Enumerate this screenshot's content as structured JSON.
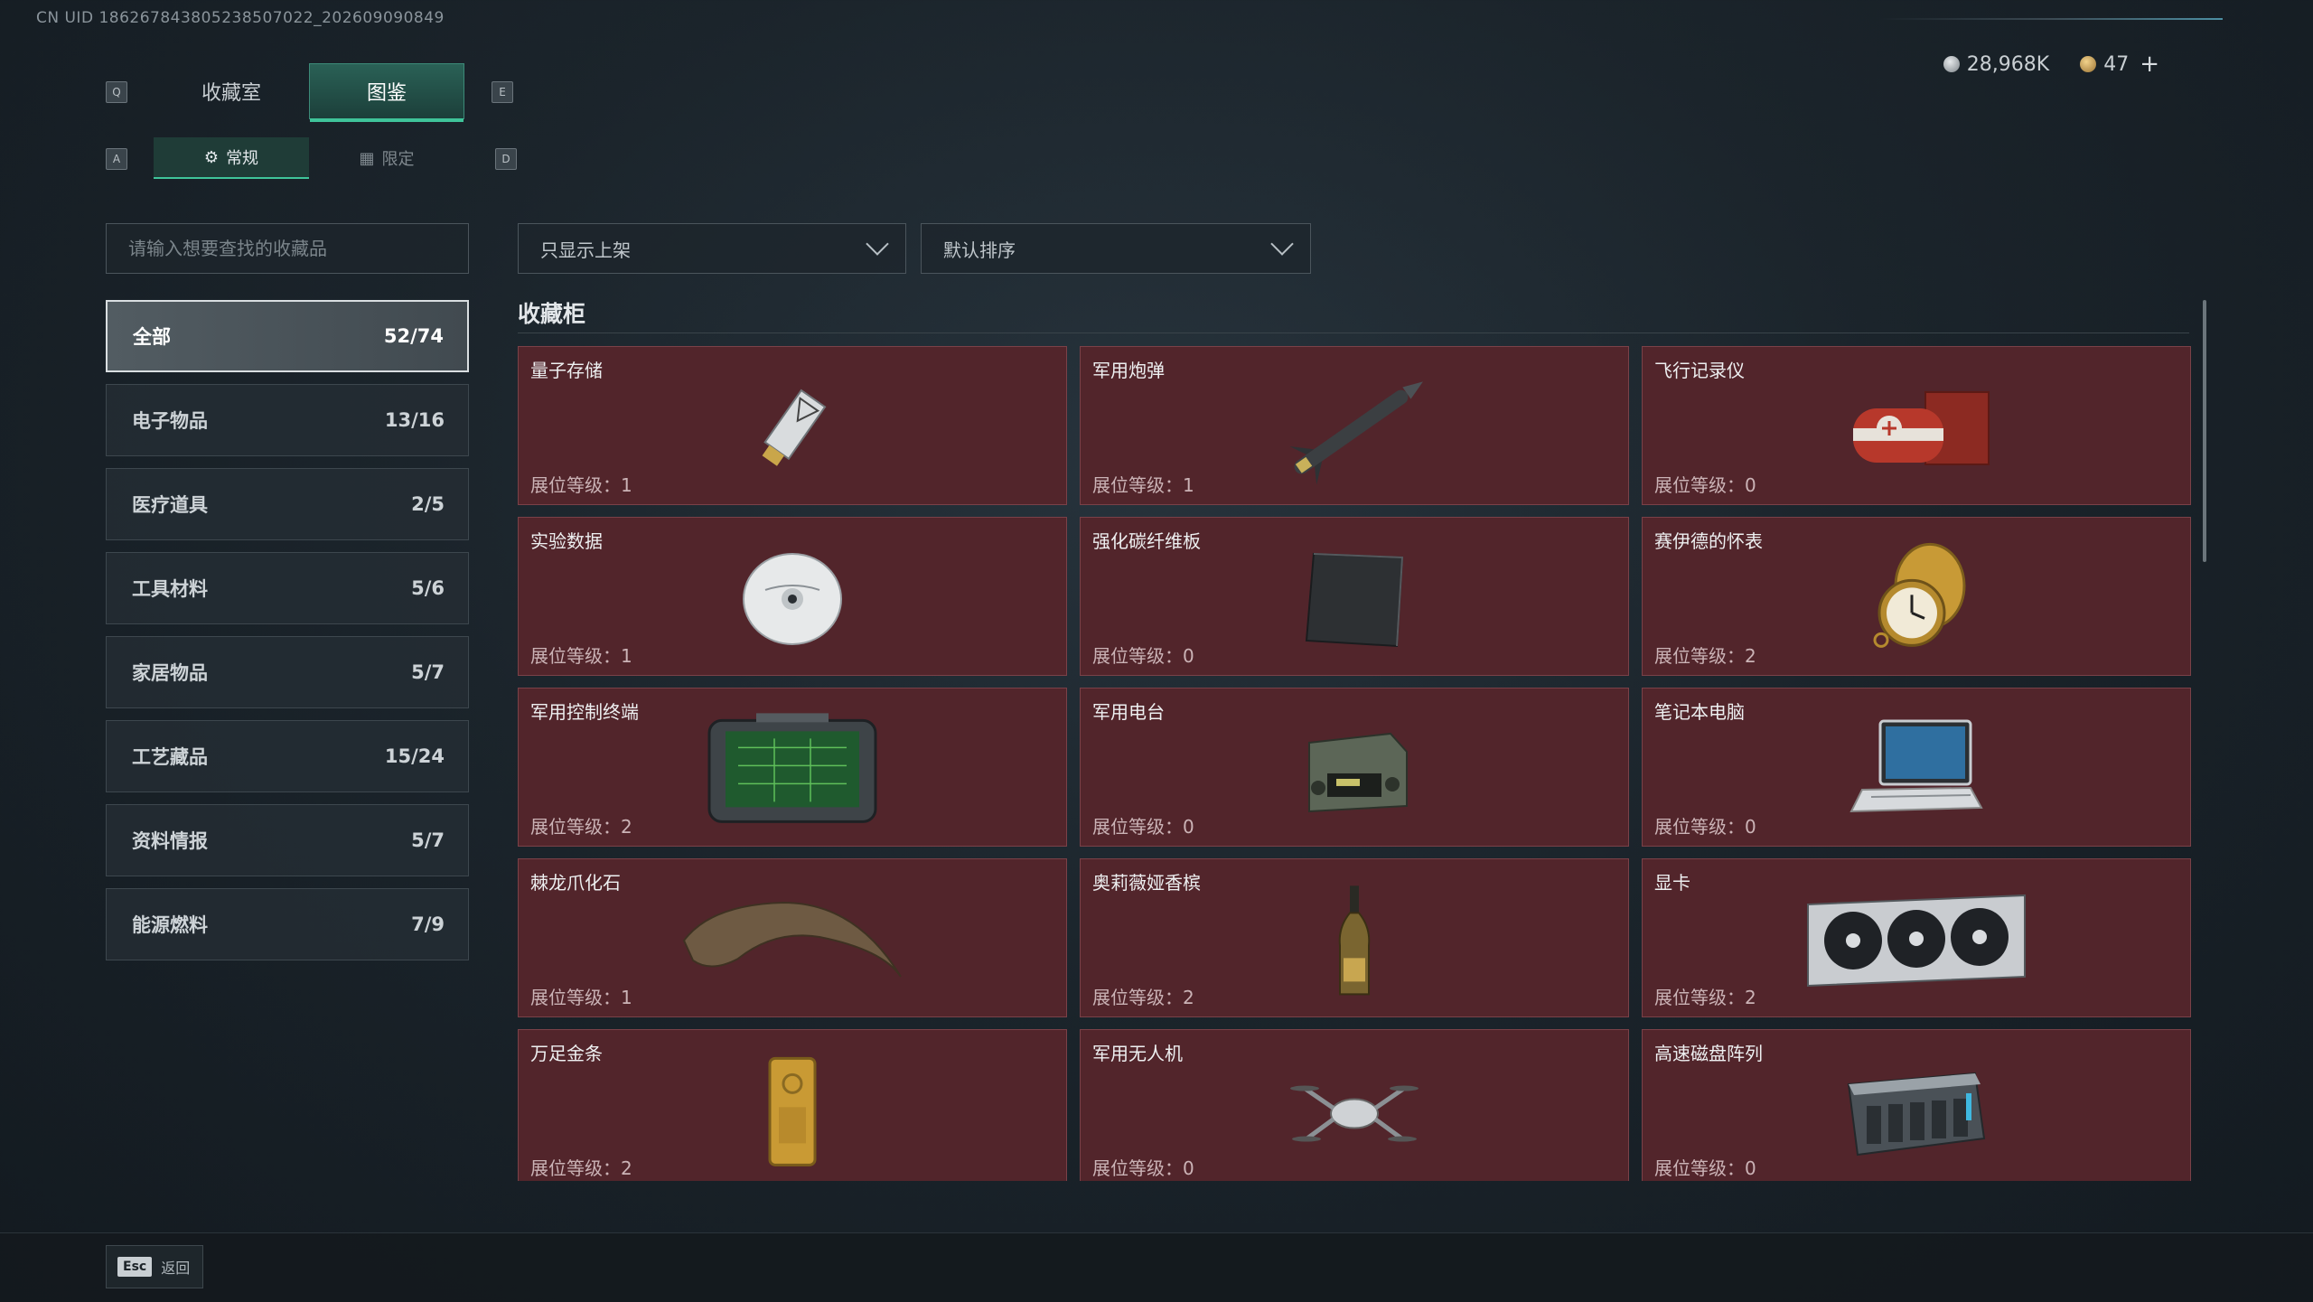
{
  "header": {
    "uid": "CN UID 1862678438052385070​22_202609090849"
  },
  "currency": {
    "silver": "28,968K",
    "gold": "47",
    "add": "+"
  },
  "tabs": {
    "prev_key": "Q",
    "next_key": "E",
    "items": [
      {
        "label": "收藏室"
      },
      {
        "label": "图鉴"
      }
    ]
  },
  "subtabs": {
    "prev_key": "A",
    "next_key": "D",
    "items": [
      {
        "label": "常规"
      },
      {
        "label": "限定"
      }
    ]
  },
  "search": {
    "placeholder": "请输入想要查找的收藏品"
  },
  "filters": {
    "shelf": "只显示上架",
    "sort": "默认排序"
  },
  "categories": [
    {
      "label": "全部",
      "count": "52/74"
    },
    {
      "label": "电子物品",
      "count": "13/16"
    },
    {
      "label": "医疗道具",
      "count": "2/5"
    },
    {
      "label": "工具材料",
      "count": "5/6"
    },
    {
      "label": "家居物品",
      "count": "5/7"
    },
    {
      "label": "工艺藏品",
      "count": "15/24"
    },
    {
      "label": "资料情报",
      "count": "5/7"
    },
    {
      "label": "能源燃料",
      "count": "7/9"
    }
  ],
  "section_title": "收藏柜",
  "items": [
    {
      "name": "量子存储",
      "level": "展位等级：1",
      "icon": "usb-drive-icon"
    },
    {
      "name": "军用炮弹",
      "level": "展位等级：1",
      "icon": "missile-icon"
    },
    {
      "name": "飞行记录仪",
      "level": "展位等级：0",
      "icon": "flight-recorder-icon"
    },
    {
      "name": "实验数据",
      "level": "展位等级：1",
      "icon": "disc-icon"
    },
    {
      "name": "强化碳纤维板",
      "level": "展位等级：0",
      "icon": "carbon-plate-icon"
    },
    {
      "name": "赛伊德的怀表",
      "level": "展位等级：2",
      "icon": "pocket-watch-icon"
    },
    {
      "name": "军用控制终端",
      "level": "展位等级：2",
      "icon": "control-terminal-icon"
    },
    {
      "name": "军用电台",
      "level": "展位等级：0",
      "icon": "radio-icon"
    },
    {
      "name": "笔记本电脑",
      "level": "展位等级：0",
      "icon": "laptop-icon"
    },
    {
      "name": "棘龙爪化石",
      "level": "展位等级：1",
      "icon": "claw-fossil-icon"
    },
    {
      "name": "奥莉薇娅香槟",
      "level": "展位等级：2",
      "icon": "champagne-icon"
    },
    {
      "name": "显卡",
      "level": "展位等级：2",
      "icon": "gpu-icon"
    },
    {
      "name": "万足金条",
      "level": "展位等级：2",
      "icon": "gold-bar-icon"
    },
    {
      "name": "军用无人机",
      "level": "展位等级：0",
      "icon": "drone-icon"
    },
    {
      "name": "高速磁盘阵列",
      "level": "展位等级：0",
      "icon": "disk-array-icon"
    }
  ],
  "footer": {
    "esc_key": "Esc",
    "back_label": "返回"
  },
  "colors": {
    "accent": "#3fc49a",
    "card_bg": "#52252b",
    "card_border": "#7a4148"
  }
}
